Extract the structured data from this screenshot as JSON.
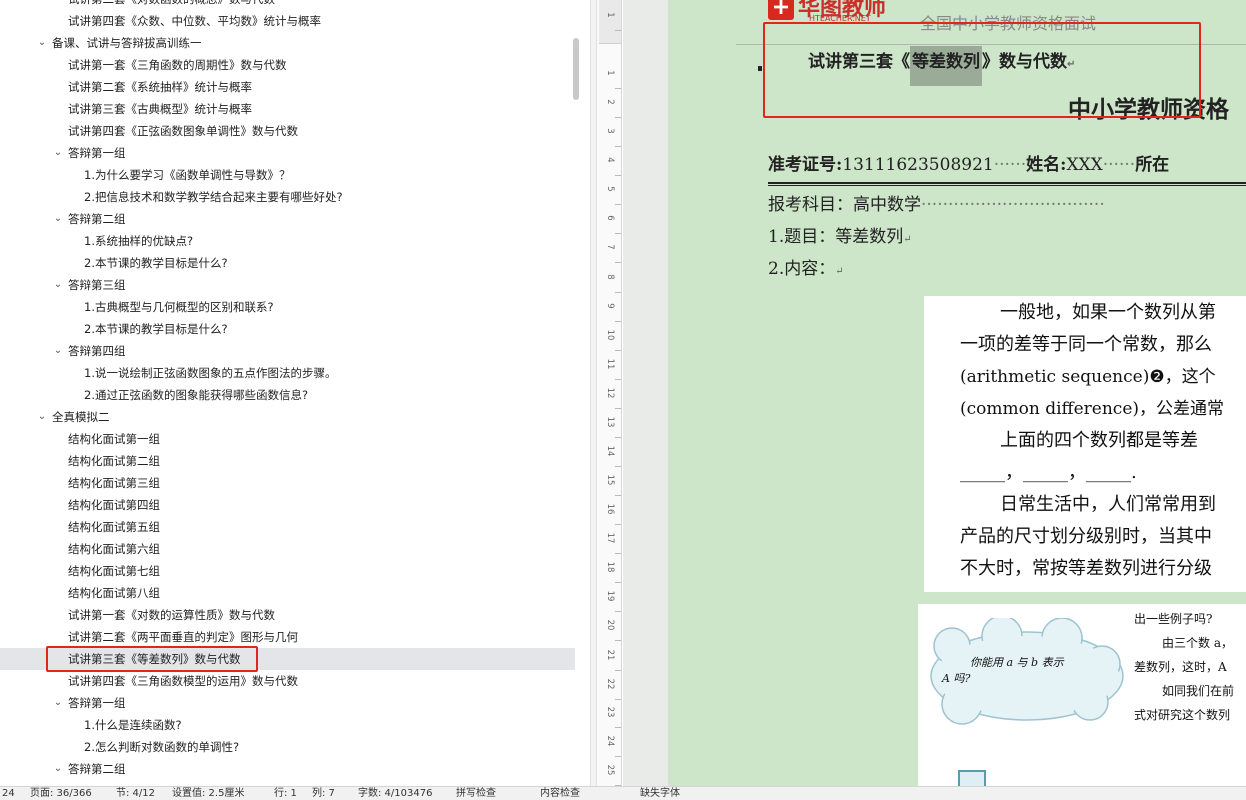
{
  "nav": {
    "items": [
      {
        "label": "试讲第二套《对数函数的概念》数与代数",
        "level": 2,
        "chevron": ""
      },
      {
        "label": "试讲第四套《众数、中位数、平均数》统计与概率",
        "level": 2,
        "chevron": ""
      },
      {
        "label": "备课、试讲与答辩拔高训练一",
        "level": 1,
        "chevron": "expanded"
      },
      {
        "label": "试讲第一套《三角函数的周期性》数与代数",
        "level": 2,
        "chevron": ""
      },
      {
        "label": "试讲第二套《系统抽样》统计与概率",
        "level": 2,
        "chevron": ""
      },
      {
        "label": "试讲第三套《古典概型》统计与概率",
        "level": 2,
        "chevron": ""
      },
      {
        "label": "试讲第四套《正弦函数图象单调性》数与代数",
        "level": 2,
        "chevron": ""
      },
      {
        "label": "答辩第一组",
        "level": 2,
        "chevron": "expanded"
      },
      {
        "label": "1.为什么要学习《函数单调性与导数》？",
        "level": 3,
        "chevron": ""
      },
      {
        "label": "2.把信息技术和数学教学结合起来主要有哪些好处?",
        "level": 3,
        "chevron": ""
      },
      {
        "label": "答辩第二组",
        "level": 2,
        "chevron": "expanded"
      },
      {
        "label": "1.系统抽样的优缺点?",
        "level": 3,
        "chevron": ""
      },
      {
        "label": "2.本节课的教学目标是什么?",
        "level": 3,
        "chevron": ""
      },
      {
        "label": "答辩第三组",
        "level": 2,
        "chevron": "expanded"
      },
      {
        "label": "1.古典概型与几何概型的区别和联系?",
        "level": 3,
        "chevron": ""
      },
      {
        "label": "2.本节课的教学目标是什么?",
        "level": 3,
        "chevron": ""
      },
      {
        "label": "答辩第四组",
        "level": 2,
        "chevron": "expanded"
      },
      {
        "label": "1.说一说绘制正弦函数图象的五点作图法的步骤。",
        "level": 3,
        "chevron": ""
      },
      {
        "label": "2.通过正弦函数的图象能获得哪些函数信息?",
        "level": 3,
        "chevron": ""
      },
      {
        "label": "全真模拟二",
        "level": 1,
        "chevron": "expanded"
      },
      {
        "label": "结构化面试第一组",
        "level": 2,
        "chevron": ""
      },
      {
        "label": "结构化面试第二组",
        "level": 2,
        "chevron": ""
      },
      {
        "label": "结构化面试第三组",
        "level": 2,
        "chevron": ""
      },
      {
        "label": "结构化面试第四组",
        "level": 2,
        "chevron": ""
      },
      {
        "label": "结构化面试第五组",
        "level": 2,
        "chevron": ""
      },
      {
        "label": "结构化面试第六组",
        "level": 2,
        "chevron": ""
      },
      {
        "label": "结构化面试第七组",
        "level": 2,
        "chevron": ""
      },
      {
        "label": "结构化面试第八组",
        "level": 2,
        "chevron": ""
      },
      {
        "label": "试讲第一套《对数的运算性质》数与代数",
        "level": 2,
        "chevron": ""
      },
      {
        "label": "试讲第二套《两平面垂直的判定》图形与几何",
        "level": 2,
        "chevron": ""
      },
      {
        "label": "试讲第三套《等差数列》数与代数",
        "level": 2,
        "chevron": "",
        "selected": true
      },
      {
        "label": "试讲第四套《三角函数模型的运用》数与代数",
        "level": 2,
        "chevron": ""
      },
      {
        "label": "答辩第一组",
        "level": 2,
        "chevron": "expanded"
      },
      {
        "label": "1.什么是连续函数?",
        "level": 3,
        "chevron": ""
      },
      {
        "label": "2.怎么判断对数函数的单调性?",
        "level": 3,
        "chevron": ""
      },
      {
        "label": "答辩第二组",
        "level": 2,
        "chevron": "expanded"
      }
    ]
  },
  "ruler": {
    "numbers": [
      "1",
      "1",
      "2",
      "3",
      "4",
      "5",
      "6",
      "7",
      "8",
      "9",
      "10",
      "11",
      "12",
      "13",
      "14",
      "15",
      "16",
      "17",
      "18",
      "19",
      "20",
      "21",
      "22",
      "23",
      "24",
      "25"
    ]
  },
  "doc": {
    "header_brand": "华图教师",
    "header_brand_en": "HTEACHER.NET",
    "header_text": "全国中小学教师资格面试",
    "heading": "试讲第三套《等差数列》数与代数",
    "heading_prefix": "试讲第三套《",
    "heading_highlight": "等差数列",
    "heading_suffix": "》数与代数",
    "title_large": "中小学教师资格",
    "candidate_line": {
      "id_label": "准考证号:",
      "id_value": "13111623508921",
      "name_label": "姓名:",
      "name_value": "XXX",
      "location_label": "所在"
    },
    "subject_line": "报考科目：高中数学",
    "item1": "1.题目：等差数列",
    "item2": "2.内容：",
    "textbook_lines": [
      "一般地，如果一个数列从第",
      "一项的差等于同一个常数，那么",
      "(arithmetic sequence)❷，这个",
      "(common difference)，公差通常",
      "上面的四个数列都是等差",
      "_____，_____，_____.",
      "日常生活中，人们常常用到",
      "产品的尺寸划分级别时，当其中",
      "不大时，常按等差数列进行分级"
    ],
    "bubble_text": "你能用 a 与 b 表示",
    "bubble_text2": "A 吗?",
    "right_lines": [
      "出一些例子吗?",
      "由三个数 a，",
      "差数列，这时，A",
      "如同我们在前",
      "式对研究这个数列"
    ]
  },
  "status": {
    "items": [
      "24",
      "页面: 36/366",
      "节: 4/12",
      "设置值: 2.5厘米",
      "行: 1",
      "列: 7",
      "字数: 4/103476",
      "拼写检查",
      "内容检查",
      "缺失字体"
    ]
  },
  "colors": {
    "highlight": "#e0261d",
    "page_bg": "#cde5c9",
    "selected_bg": "#e3e5e8"
  }
}
